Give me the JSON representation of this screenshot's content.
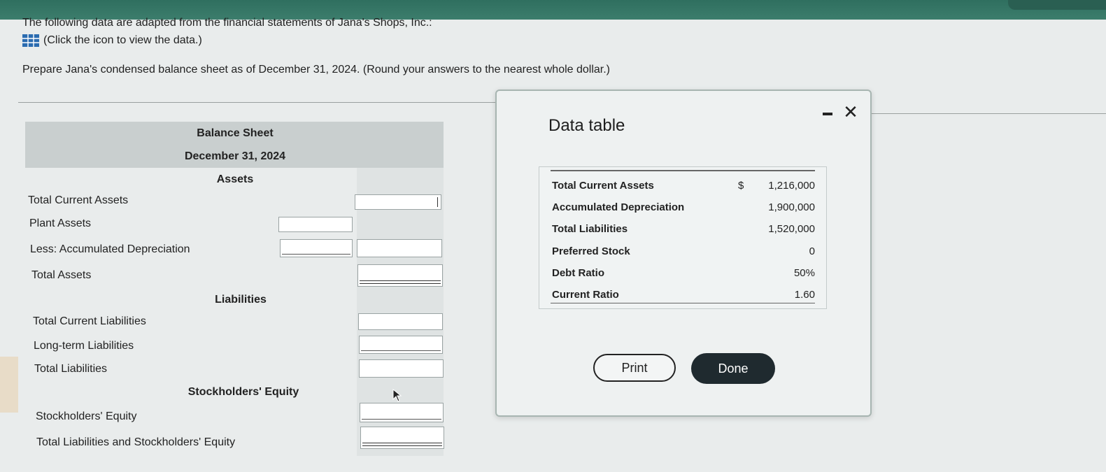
{
  "intro_text": "The following data are adapted from the financial statements of Jana's Shops, Inc.:",
  "view_data_link": "(Click the icon to view the data.)",
  "instruction": "Prepare Jana's condensed balance sheet as of December 31, 2024. (Round your answers to the nearest whole dollar.)",
  "balance_sheet": {
    "title": "Balance Sheet",
    "date": "December 31, 2024",
    "sections": {
      "assets": "Assets",
      "liabilities": "Liabilities",
      "equity": "Stockholders' Equity"
    },
    "rows": {
      "total_current_assets": "Total Current Assets",
      "plant_assets": "Plant Assets",
      "less_accum_dep": "Less: Accumulated Depreciation",
      "total_assets": "Total Assets",
      "total_current_liabilities": "Total Current Liabilities",
      "long_term_liabilities": "Long-term Liabilities",
      "total_liabilities": "Total Liabilities",
      "stockholders_equity": "Stockholders' Equity",
      "total_liab_and_equity": "Total Liabilities and Stockholders' Equity"
    }
  },
  "modal": {
    "title": "Data table",
    "rows": [
      {
        "label": "Total Current Assets",
        "currency": "$",
        "value": "1,216,000"
      },
      {
        "label": "Accumulated Depreciation",
        "currency": "",
        "value": "1,900,000"
      },
      {
        "label": "Total Liabilities",
        "currency": "",
        "value": "1,520,000"
      },
      {
        "label": "Preferred Stock",
        "currency": "",
        "value": "0"
      },
      {
        "label": "Debt Ratio",
        "currency": "",
        "value": "50%"
      },
      {
        "label": "Current Ratio",
        "currency": "",
        "value": "1.60"
      }
    ],
    "print_label": "Print",
    "done_label": "Done",
    "close_glyph": "✕"
  },
  "icons": {
    "data_icon": "table-grid-icon",
    "minimize": "minimize-icon",
    "close": "close-icon",
    "cursor": "mouse-pointer-icon"
  },
  "colors": {
    "topbar": "#2f6f5f",
    "done_button": "#1f2a2f",
    "grid_icon": "#2b6cb0"
  }
}
